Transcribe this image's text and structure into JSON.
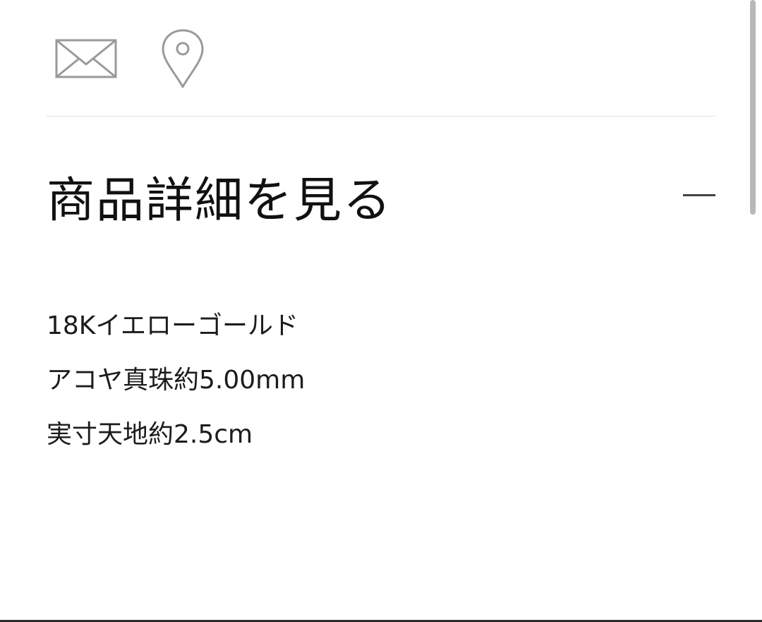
{
  "contact_icons": [
    {
      "icon": "envelope-icon"
    },
    {
      "icon": "map-pin-icon"
    }
  ],
  "details": {
    "title": "商品詳細を見る",
    "toggle_icon": "minus-icon",
    "expanded": true,
    "lines": [
      "18Kイエローゴールド",
      "アコヤ真珠約5.00mm",
      "実寸天地約2.5cm"
    ]
  },
  "colors": {
    "icon_gray": "#9a9a9a",
    "title_text": "#111111",
    "body_text": "#1c1c1c",
    "divider": "#e3e3e3",
    "scrollbar": "#b8b8b8"
  }
}
